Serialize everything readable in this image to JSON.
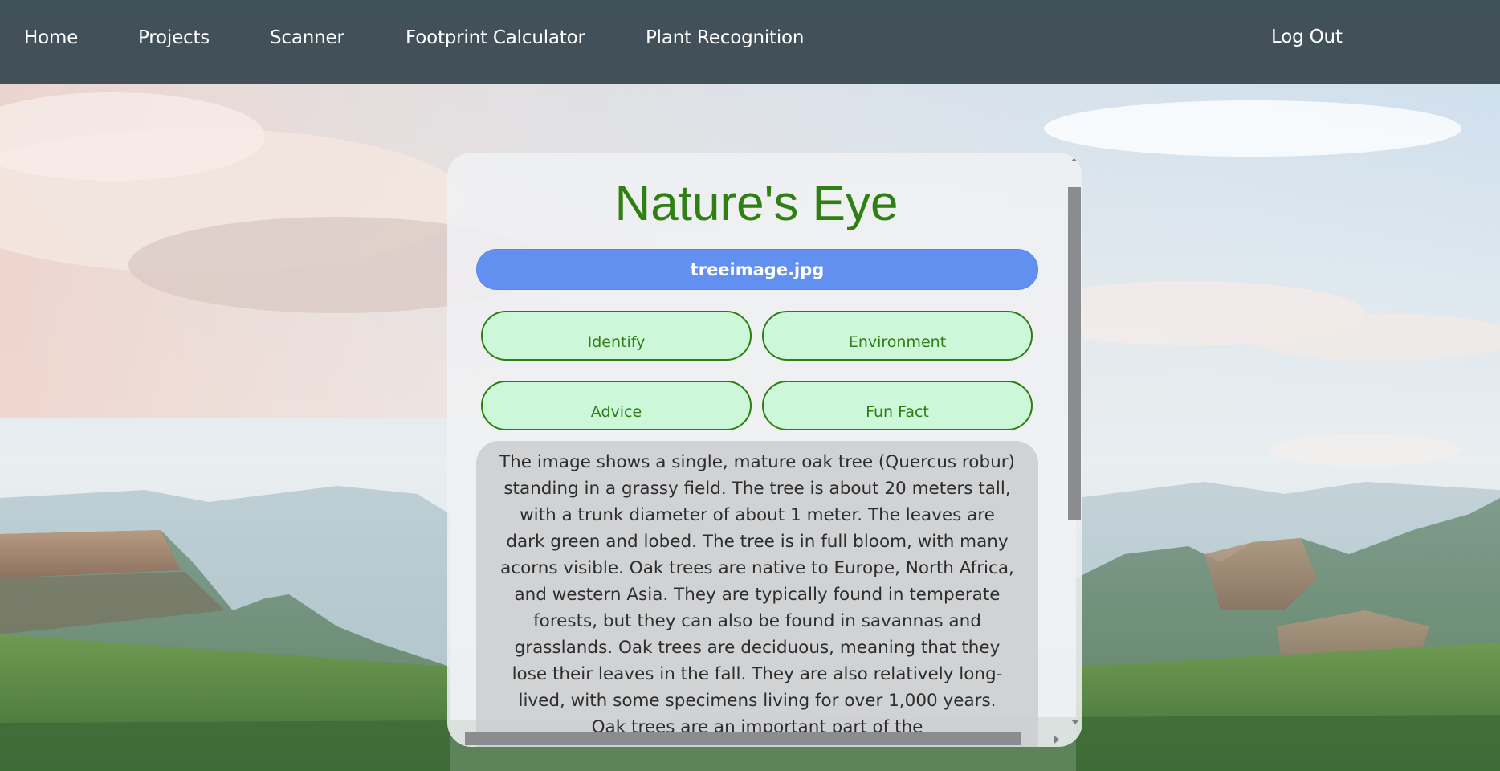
{
  "nav": {
    "home": "Home",
    "projects": "Projects",
    "scanner": "Scanner",
    "footprint": "Footprint Calculator",
    "plant": "Plant Recognition",
    "logout": "Log Out"
  },
  "card": {
    "title": "Nature's Eye",
    "file_label": "treeimage.jpg",
    "buttons": {
      "identify": "Identify",
      "environment": "Environment",
      "advice": "Advice",
      "fun_fact": "Fun Fact"
    },
    "result_text": "The image shows a single, mature oak tree (Quercus robur) standing in a grassy field. The tree is about 20 meters tall, with a trunk diameter of about 1 meter. The leaves are dark green and lobed. The tree is in full bloom, with many acorns visible. Oak trees are native to Europe, North Africa, and western Asia. They are typically found in temperate forests, but they can also be found in savannas and grasslands. Oak trees are deciduous, meaning that they lose their leaves in the fall. They are also relatively long-lived, with some specimens living for over 1,000 years. Oak trees are an important part of the"
  },
  "colors": {
    "nav_bg": "#37464e",
    "title_green": "#2f7f12",
    "file_button_blue": "#6190f0",
    "action_button_fill": "#ccf7d8",
    "action_button_border": "#2f7e12"
  },
  "icons": {
    "scroll_up": "triangle-up",
    "scroll_down": "triangle-down",
    "scroll_right": "triangle-right"
  }
}
